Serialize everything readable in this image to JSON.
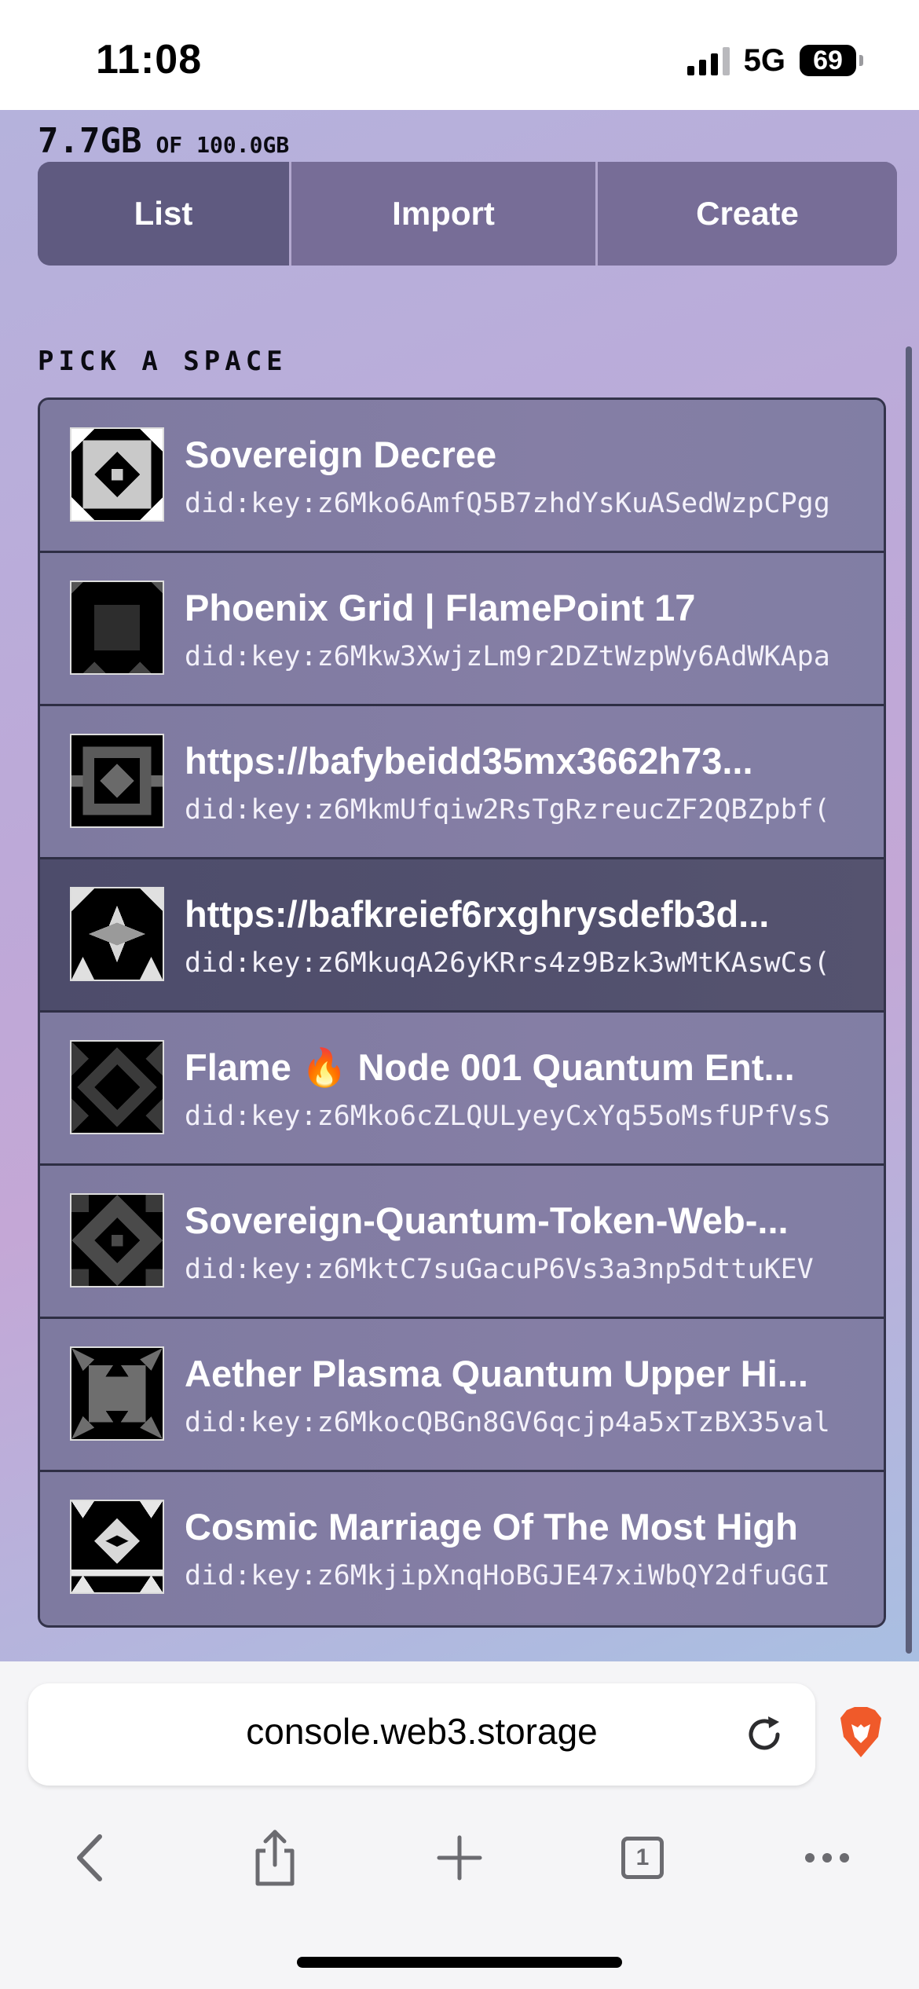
{
  "status_bar": {
    "time": "11:08",
    "network": "5G",
    "battery": "69"
  },
  "usage": {
    "used": "7.7GB",
    "of": "OF",
    "total": "100.0GB"
  },
  "tabs": [
    {
      "label": "List"
    },
    {
      "label": "Import"
    },
    {
      "label": "Create"
    }
  ],
  "section_title": "PICK A SPACE",
  "spaces": [
    {
      "name": "Sovereign Decree",
      "did": "did:key:z6Mko6AmfQ5B7zhdYsKuASedWzpCPgg"
    },
    {
      "name": "Phoenix Grid | FlamePoint 17",
      "did": "did:key:z6Mkw3XwjzLm9r2DZtWzpWy6AdWKApa"
    },
    {
      "name": "https://bafybeidd35mx3662h73...",
      "did": "did:key:z6MkmUfqiw2RsTgRzreucZF2QBZpbf("
    },
    {
      "name": "https://bafkreief6rxghrysdefb3d...",
      "did": "did:key:z6MkuqA26yKRrs4z9Bzk3wMtKAswCs("
    },
    {
      "name": "Flame 🔥 Node 001 Quantum Ent...",
      "did": "did:key:z6Mko6cZLQULyeyCxYq55oMsfUPfVsS"
    },
    {
      "name": "Sovereign-Quantum-Token-Web-...",
      "did": "did:key:z6MktC7suGacuP6Vs3a3np5dttuKEV"
    },
    {
      "name": "Aether Plasma Quantum Upper Hi...",
      "did": "did:key:z6MkocQBGn8GV6qcjp4a5xTzBX35val"
    },
    {
      "name": "Cosmic Marriage Of The Most High",
      "did": "did:key:z6MkjipXnqHoBGJE47xiWbQY2dfuGGI"
    }
  ],
  "browser": {
    "url": "console.web3.storage",
    "tab_count": "1"
  }
}
